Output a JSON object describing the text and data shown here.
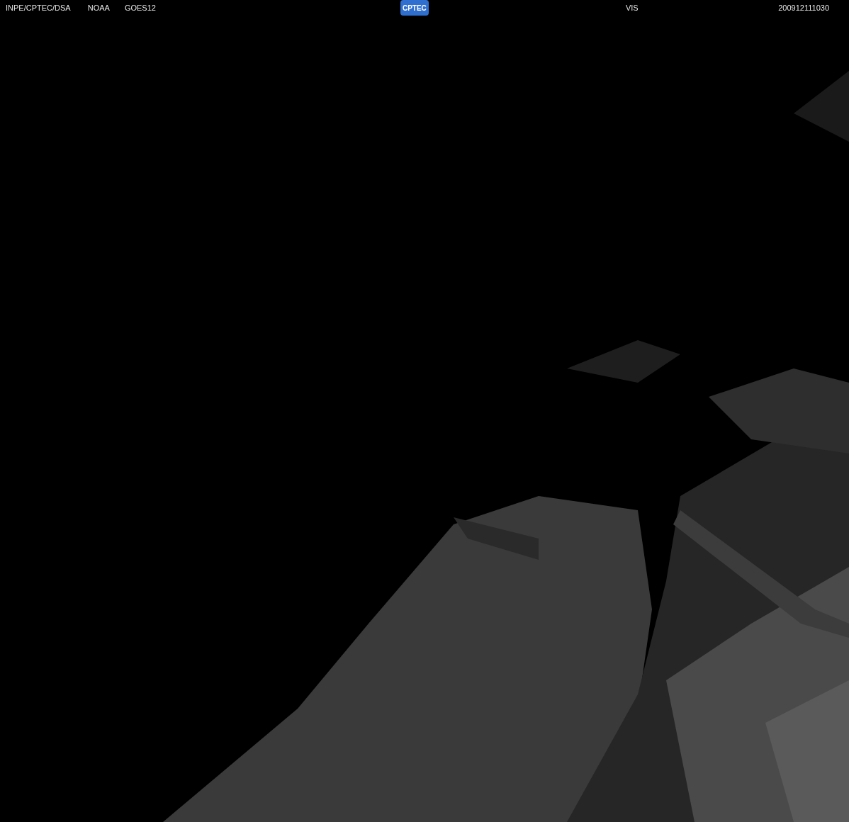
{
  "header": {
    "source": "INPE/CPTEC/DSA",
    "agency": "NOAA",
    "satellite": "GOES12",
    "logo": "CPTEC",
    "channel": "VIS",
    "timestamp": "200912111030"
  }
}
